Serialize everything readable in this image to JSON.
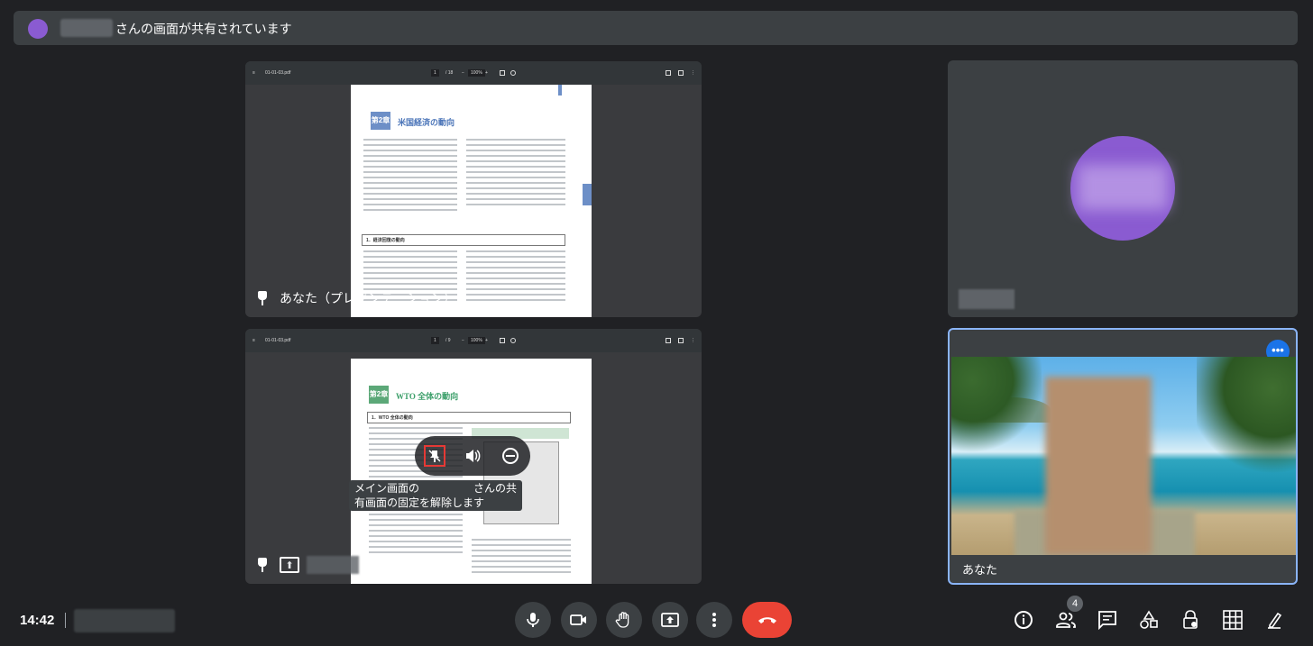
{
  "banner": {
    "text": "さんの画面が共有されています"
  },
  "tiles": {
    "presentation1": {
      "label": "あなた（プレゼンテーション）",
      "pdf": {
        "filename": "01-01-03.pdf",
        "page": "1",
        "page_total": "/ 18",
        "zoom": "100%",
        "chapter_badge": "第2章",
        "chapter_title": "米国経済の動向",
        "section_title": "1．経済回復の動向"
      }
    },
    "presentation2": {
      "pdf": {
        "filename": "01-01-03.pdf",
        "page": "1",
        "page_total": "/ 9",
        "zoom": "100%",
        "chapter_badge": "第2章",
        "chapter_title": "WTO 全体の動向",
        "section_title": "1．WTO 全体の動向"
      },
      "hover_controls": {
        "unpin": "unpin-icon",
        "volume": "volume-icon",
        "remove": "minus-circle-icon"
      },
      "tooltip": "メイン画面の　　　　　さんの共有画面の固定を解除します"
    },
    "participant": {},
    "self": {
      "label": "あなた",
      "more": "•••"
    }
  },
  "bottom_bar": {
    "time": "14:42",
    "controls": [
      "mic-icon",
      "camera-icon",
      "raise-hand-icon",
      "present-icon",
      "more-vert-icon",
      "end-call-icon"
    ],
    "right": [
      "info-icon",
      "people-icon",
      "chat-icon",
      "activities-icon",
      "host-controls-icon",
      "grid-icon",
      "caption-icon"
    ],
    "participants_count": "4"
  },
  "colors": {
    "background": "#202124",
    "tile": "#3c4043",
    "end_call": "#ea4335",
    "accent": "#1a73e8",
    "active_border": "#8ab4f8",
    "avatar": "#8a5bd1"
  }
}
